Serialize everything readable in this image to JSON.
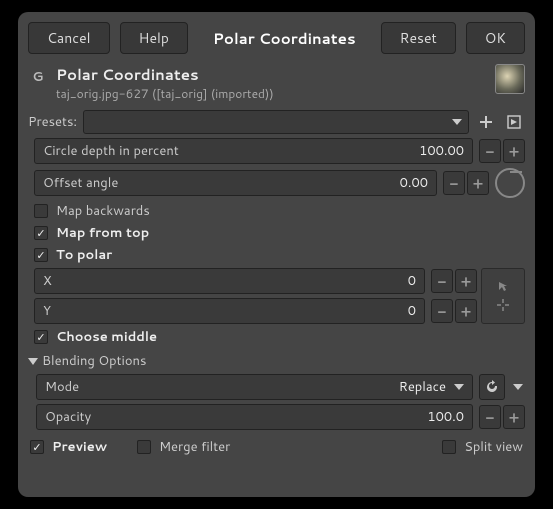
{
  "topbar": {
    "cancel": "Cancel",
    "help": "Help",
    "title": "Polar Coordinates",
    "reset": "Reset",
    "ok": "OK"
  },
  "header": {
    "title": "Polar Coordinates",
    "subtitle": "taj_orig.jpg-627 ([taj_orig] (imported))"
  },
  "presets": {
    "label": "Presets:"
  },
  "fields": {
    "circle_depth": {
      "label": "Circle depth in percent",
      "value": "100.00"
    },
    "offset_angle": {
      "label": "Offset angle",
      "value": "0.00"
    },
    "x": {
      "label": "X",
      "value": "0"
    },
    "y": {
      "label": "Y",
      "value": "0"
    },
    "opacity": {
      "label": "Opacity",
      "value": "100.0"
    }
  },
  "checks": {
    "map_backwards": {
      "label": "Map backwards",
      "checked": false
    },
    "map_from_top": {
      "label": "Map from top",
      "checked": true
    },
    "to_polar": {
      "label": "To polar",
      "checked": true
    },
    "choose_middle": {
      "label": "Choose middle",
      "checked": true
    },
    "preview": {
      "label": "Preview",
      "checked": true
    },
    "merge_filter": {
      "label": "Merge filter",
      "checked": false
    },
    "split_view": {
      "label": "Split view",
      "checked": false
    }
  },
  "blending": {
    "section": "Blending Options",
    "mode_label": "Mode",
    "mode_value": "Replace"
  }
}
